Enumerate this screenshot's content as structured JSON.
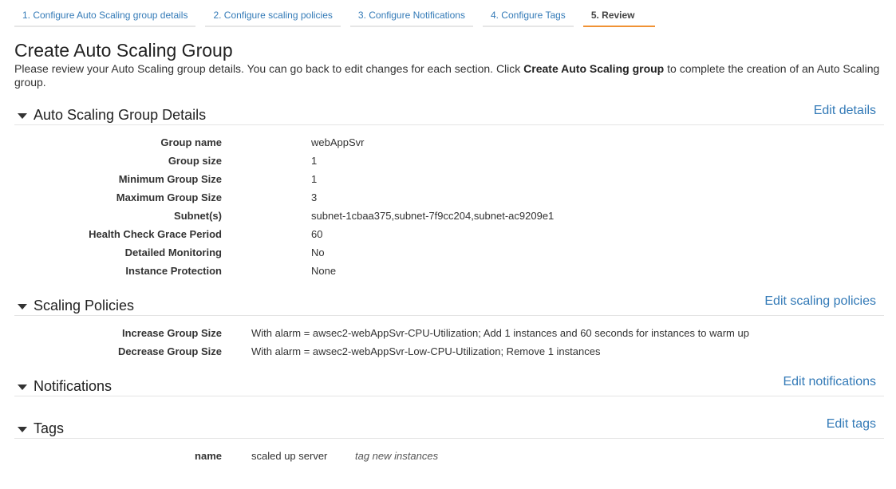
{
  "wizard": {
    "steps": [
      {
        "label": "1. Configure Auto Scaling group details"
      },
      {
        "label": "2. Configure scaling policies"
      },
      {
        "label": "3. Configure Notifications"
      },
      {
        "label": "4. Configure Tags"
      },
      {
        "label": "5. Review"
      }
    ],
    "active_step": 5,
    "active_color": "#f09234"
  },
  "page": {
    "title": "Create Auto Scaling Group",
    "intro_before": "Please review your Auto Scaling group details. You can go back to edit changes for each section. Click ",
    "intro_bold": "Create Auto Scaling group",
    "intro_after": " to complete the creation of an Auto Scaling group."
  },
  "details": {
    "title": "Auto Scaling Group Details",
    "edit_label": "Edit details",
    "rows": [
      {
        "key": "Group name",
        "value": "webAppSvr"
      },
      {
        "key": "Group size",
        "value": "1"
      },
      {
        "key": "Minimum Group Size",
        "value": "1"
      },
      {
        "key": "Maximum Group Size",
        "value": "3"
      },
      {
        "key": "Subnet(s)",
        "value": "subnet-1cbaa375,subnet-7f9cc204,subnet-ac9209e1"
      },
      {
        "key": "Health Check Grace Period",
        "value": "60"
      },
      {
        "key": "Detailed Monitoring",
        "value": "No"
      },
      {
        "key": "Instance Protection",
        "value": "None"
      }
    ]
  },
  "policies": {
    "title": "Scaling Policies",
    "edit_label": "Edit scaling policies",
    "rows": [
      {
        "key": "Increase Group Size",
        "value": "With alarm = awsec2-webAppSvr-CPU-Utilization; Add 1 instances and 60 seconds for instances to warm up"
      },
      {
        "key": "Decrease Group Size",
        "value": "With alarm = awsec2-webAppSvr-Low-CPU-Utilization; Remove 1 instances"
      }
    ]
  },
  "notifications": {
    "title": "Notifications",
    "edit_label": "Edit notifications"
  },
  "tags": {
    "title": "Tags",
    "edit_label": "Edit tags",
    "rows": [
      {
        "key": "name",
        "value": "scaled up server",
        "note": "tag new instances"
      }
    ]
  },
  "colors": {
    "link": "#337ab7",
    "text": "#333333",
    "divider": "#e4e4e4"
  }
}
